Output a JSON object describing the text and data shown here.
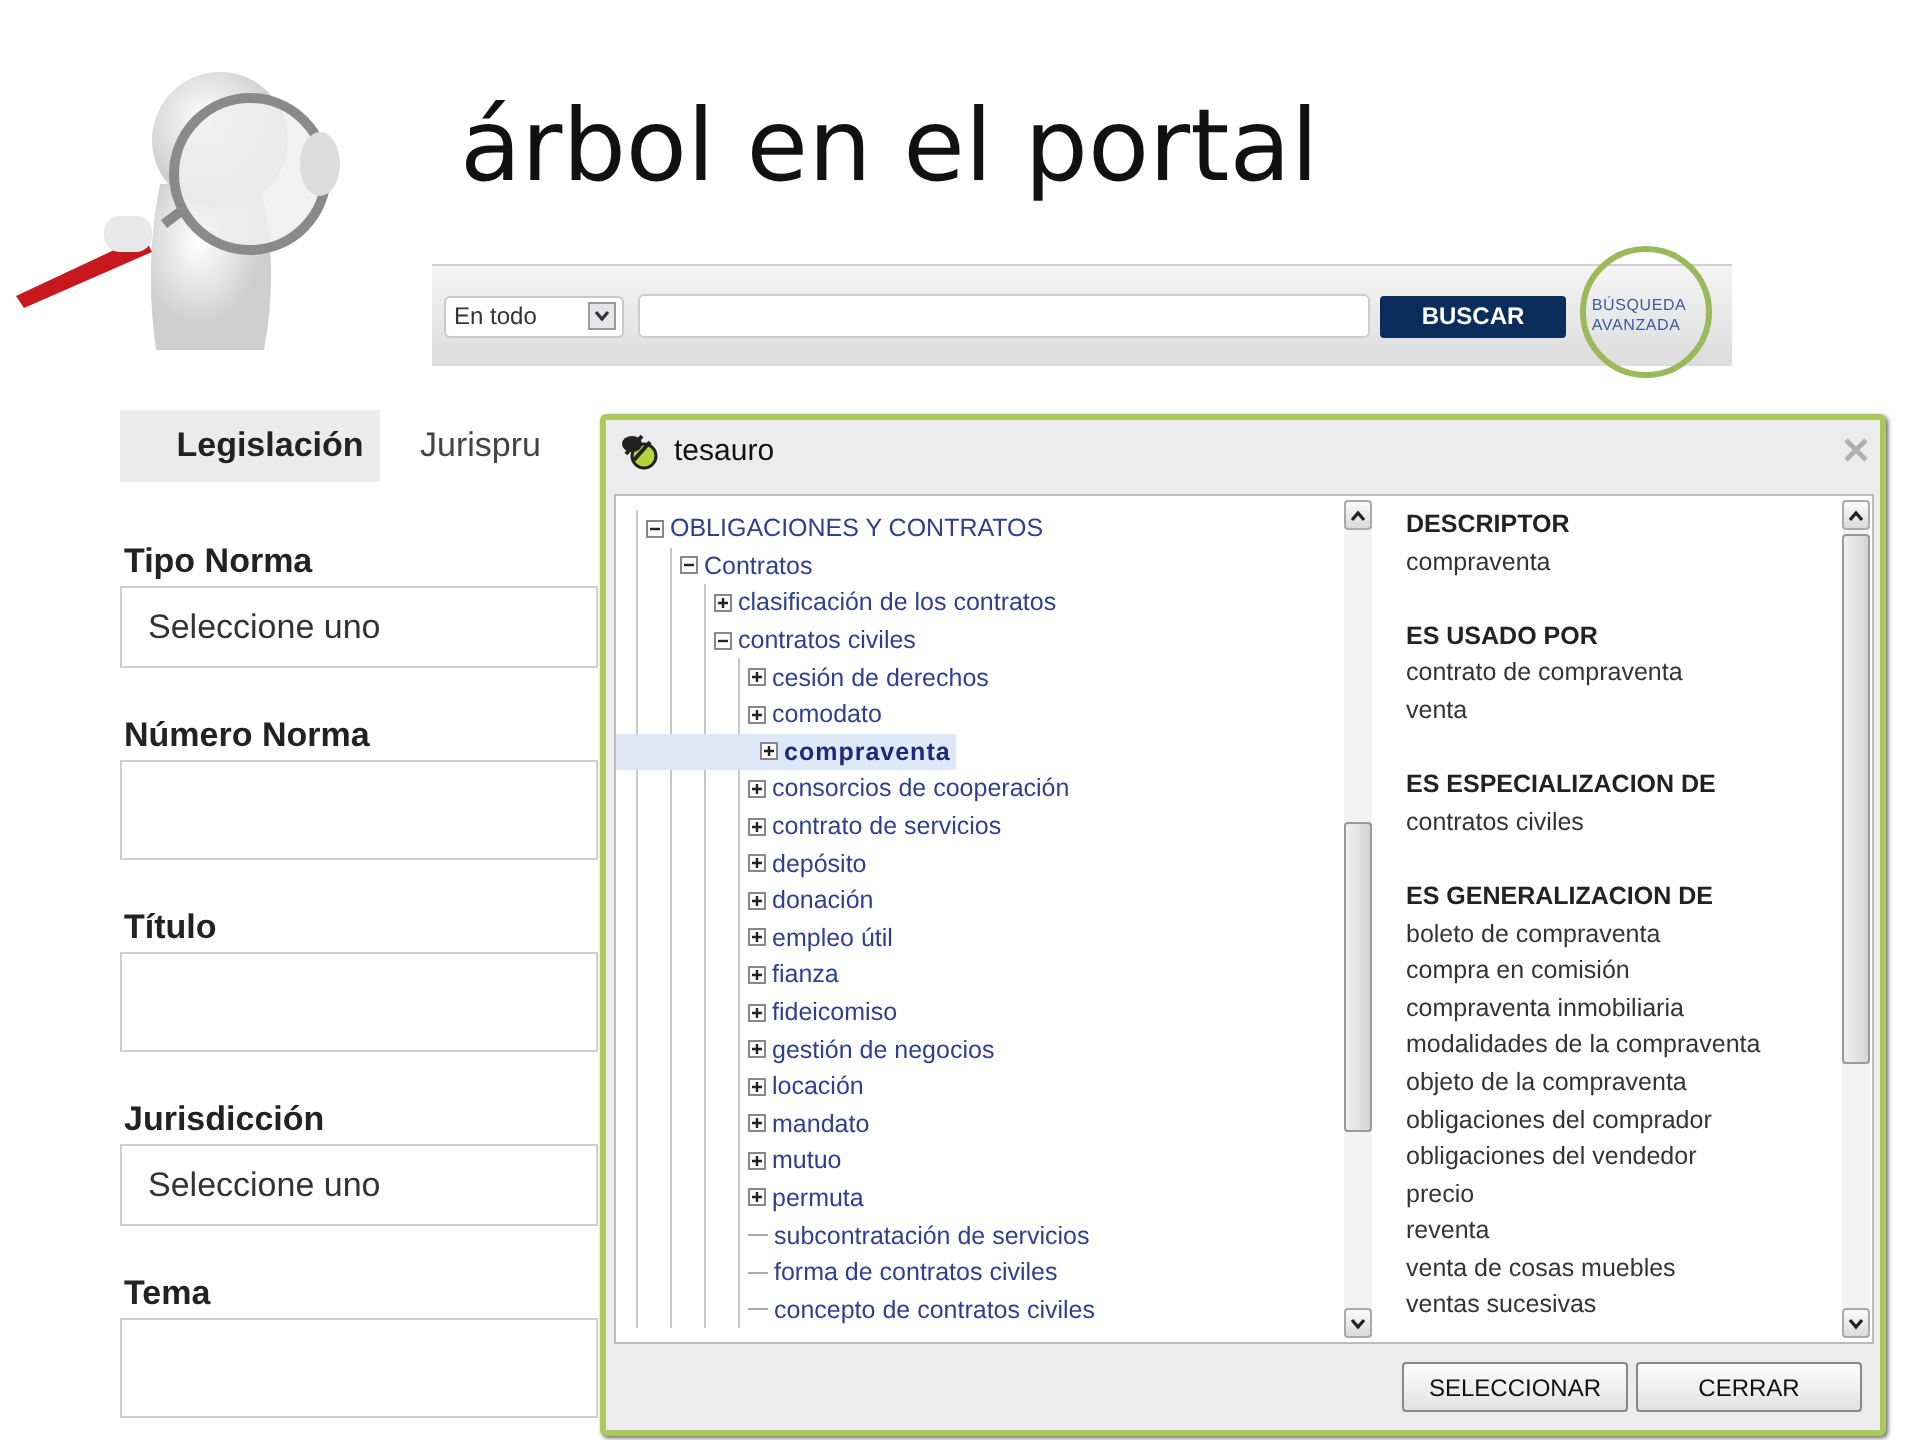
{
  "slide_title": "árbol en el portal",
  "search_bar": {
    "scope": "En todo",
    "button": "BUSCAR",
    "advanced_link": "BÚSQUEDA AVANZADA"
  },
  "form": {
    "tabs": [
      {
        "label": "Legislación",
        "selected": true
      },
      {
        "label": "Jurispru",
        "selected": false
      }
    ],
    "fields": [
      {
        "label": "Tipo Norma",
        "kind": "select",
        "value": "Seleccione uno"
      },
      {
        "label": "Número Norma",
        "kind": "text"
      },
      {
        "label": "Título",
        "kind": "text"
      },
      {
        "label": "Jurisdicción",
        "kind": "select",
        "value": "Seleccione uno"
      },
      {
        "label": "Tema",
        "kind": "text"
      }
    ]
  },
  "dialog": {
    "title": "tesauro",
    "tree": [
      {
        "label": "OBLIGACIONES Y CONTRATOS",
        "kind": "branch",
        "expanded": true,
        "selected": false,
        "children": [
          {
            "label": "Contratos",
            "kind": "branch",
            "expanded": true,
            "selected": false,
            "children": [
              {
                "label": "clasificación de los contratos",
                "kind": "branch",
                "expanded": false,
                "selected": false
              },
              {
                "label": "contratos civiles",
                "kind": "branch",
                "expanded": true,
                "selected": false,
                "children": [
                  {
                    "label": "cesión de derechos",
                    "kind": "branch",
                    "expanded": false,
                    "selected": false
                  },
                  {
                    "label": "comodato",
                    "kind": "branch",
                    "expanded": false,
                    "selected": false
                  },
                  {
                    "label": "compraventa",
                    "kind": "branch",
                    "expanded": false,
                    "selected": true
                  },
                  {
                    "label": "consorcios de cooperación",
                    "kind": "branch",
                    "expanded": false,
                    "selected": false
                  },
                  {
                    "label": "contrato de servicios",
                    "kind": "branch",
                    "expanded": false,
                    "selected": false
                  },
                  {
                    "label": "depósito",
                    "kind": "branch",
                    "expanded": false,
                    "selected": false
                  },
                  {
                    "label": "donación",
                    "kind": "branch",
                    "expanded": false,
                    "selected": false
                  },
                  {
                    "label": "empleo útil",
                    "kind": "branch",
                    "expanded": false,
                    "selected": false
                  },
                  {
                    "label": "fianza",
                    "kind": "branch",
                    "expanded": false,
                    "selected": false
                  },
                  {
                    "label": "fideicomiso",
                    "kind": "branch",
                    "expanded": false,
                    "selected": false
                  },
                  {
                    "label": "gestión de negocios",
                    "kind": "branch",
                    "expanded": false,
                    "selected": false
                  },
                  {
                    "label": "locación",
                    "kind": "branch",
                    "expanded": false,
                    "selected": false
                  },
                  {
                    "label": "mandato",
                    "kind": "branch",
                    "expanded": false,
                    "selected": false
                  },
                  {
                    "label": "mutuo",
                    "kind": "branch",
                    "expanded": false,
                    "selected": false
                  },
                  {
                    "label": "permuta",
                    "kind": "branch",
                    "expanded": false,
                    "selected": false
                  },
                  {
                    "label": "subcontratación de servicios",
                    "kind": "leaf",
                    "selected": false
                  },
                  {
                    "label": "forma de contratos civiles",
                    "kind": "leaf",
                    "selected": false
                  },
                  {
                    "label": "concepto de contratos civiles",
                    "kind": "leaf",
                    "selected": false
                  }
                ]
              }
            ]
          }
        ]
      }
    ],
    "details": [
      {
        "heading": "DESCRIPTOR",
        "terms": [
          "compraventa"
        ]
      },
      {
        "heading": "ES USADO POR",
        "terms": [
          "contrato de compraventa",
          "venta"
        ]
      },
      {
        "heading": "ES ESPECIALIZACION DE",
        "terms": [
          "contratos civiles"
        ]
      },
      {
        "heading": "ES GENERALIZACION DE",
        "terms": [
          "boleto de compraventa",
          "compra en comisión",
          "compraventa inmobiliaria",
          "modalidades de la compraventa",
          "objeto de la compraventa",
          "obligaciones del comprador",
          "obligaciones del vendedor",
          "precio",
          "reventa",
          "venta de cosas muebles",
          "ventas sucesivas"
        ]
      }
    ],
    "buttons": [
      "SELECCIONAR",
      "CERRAR"
    ]
  }
}
